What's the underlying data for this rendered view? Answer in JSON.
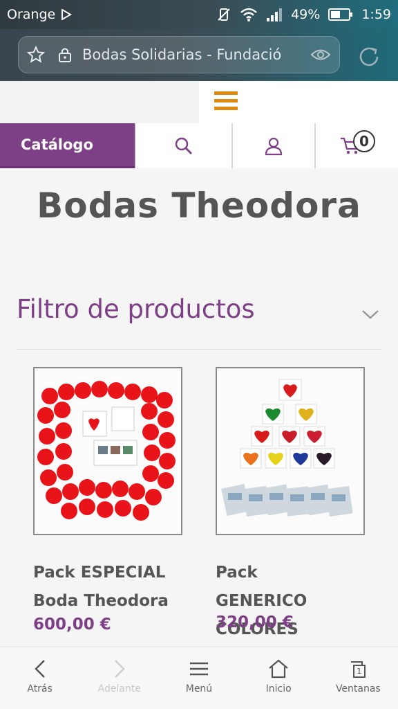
{
  "status": {
    "carrier": "Orange",
    "battery": "49%",
    "time": "1:59"
  },
  "browser": {
    "url_text": "Bodas Solidarias - Fundació"
  },
  "nav": {
    "catalog_label": "Catálogo",
    "cart_count": "0"
  },
  "page": {
    "title": "Bodas Theodora",
    "filter_title": "Filtro de productos"
  },
  "products": [
    {
      "name_line1": "Pack ESPECIAL",
      "name_line2": "Boda Theodora",
      "price": "600,00 €"
    },
    {
      "name_line1": "Pack",
      "name_line2": "GENERICO",
      "name_line3": "COLORES",
      "price": "320,00 €"
    }
  ],
  "bottom_bar": {
    "back": "Atrás",
    "forward": "Adelante",
    "menu": "Menú",
    "home": "Inicio",
    "windows": "Ventanas",
    "windows_count": "1"
  },
  "colors": {
    "brand_purple": "#7d3f85",
    "hamburger_orange": "#e08a12"
  }
}
